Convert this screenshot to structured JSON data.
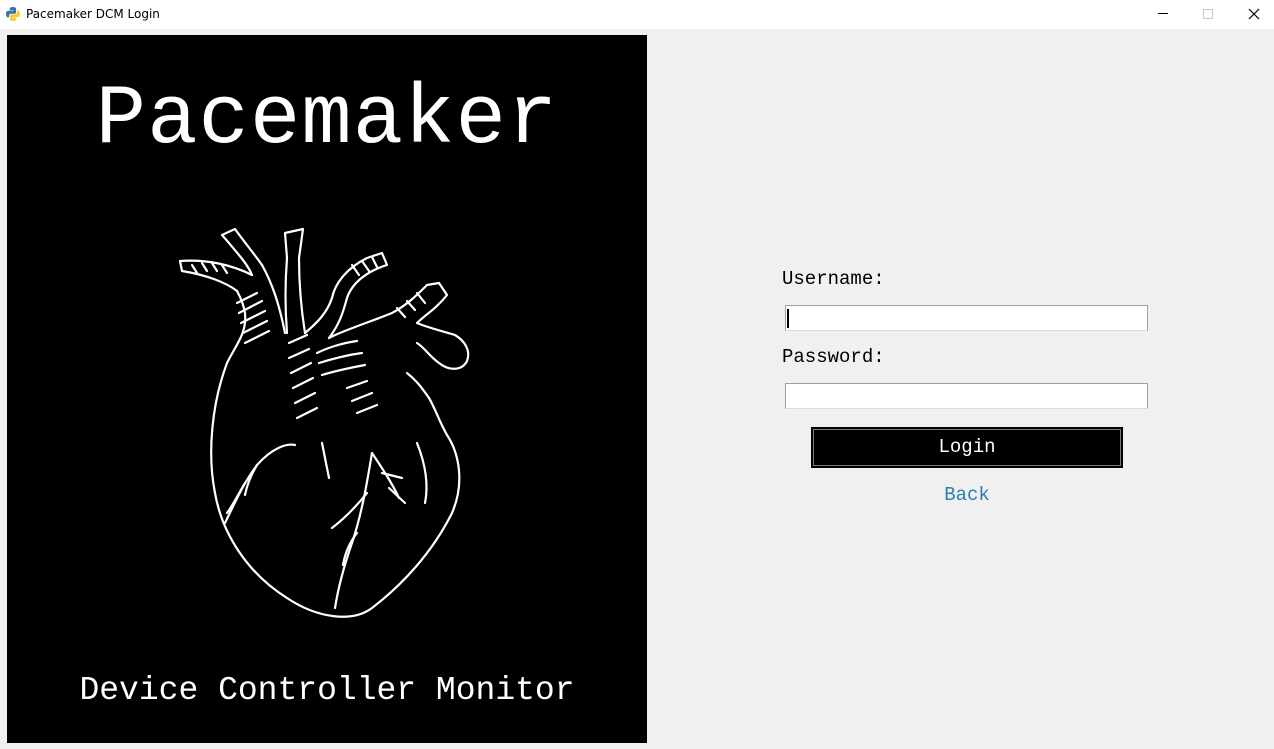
{
  "window": {
    "title": "Pacemaker DCM Login"
  },
  "logo": {
    "title": "Pacemaker",
    "subtitle": "Device Controller Monitor"
  },
  "form": {
    "username_label": "Username:",
    "username_value": "",
    "password_label": "Password:",
    "password_value": "",
    "login_label": "Login",
    "back_label": "Back"
  },
  "colors": {
    "background": "#f0f0f0",
    "logo_background": "#000000",
    "button_background": "#000000",
    "link": "#2a7fb0"
  }
}
